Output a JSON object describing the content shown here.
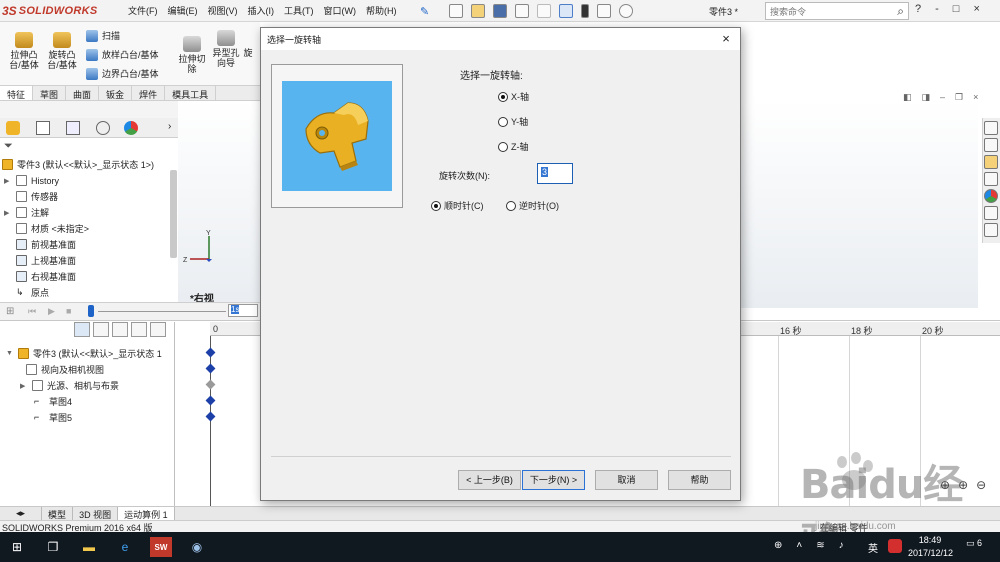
{
  "app": {
    "brand_prefix": "3S",
    "brand": "SOLIDWORKS",
    "menus": [
      "文件(F)",
      "编辑(E)",
      "视图(V)",
      "插入(I)",
      "工具(T)",
      "窗口(W)",
      "帮助(H)"
    ],
    "document_name": "零件3 *",
    "search_placeholder": "搜索命令",
    "win_buttons": [
      "?",
      "-",
      "□",
      "×"
    ]
  },
  "ribbon": {
    "buttons": [
      {
        "label": "拉伸凸\n台/基体"
      },
      {
        "label": "旋转凸\n台/基体"
      },
      {
        "label": "拉伸切\n除"
      },
      {
        "label": "异型孔\n向导"
      },
      {
        "label": "旋"
      }
    ],
    "small": [
      "扫描",
      "放样凸台/基体",
      "边界凸台/基体"
    ]
  },
  "cm_tabs": [
    "特征",
    "草图",
    "曲面",
    "钣金",
    "焊件",
    "模具工具"
  ],
  "feature_tree": {
    "root": "零件3 (默认<<默认>_显示状态 1>)",
    "items": [
      {
        "label": "History",
        "expand": true
      },
      {
        "label": "传感器",
        "expand": false
      },
      {
        "label": "注解",
        "expand": true
      },
      {
        "label": "材质 <未指定>",
        "expand": false
      },
      {
        "label": "前视基准面",
        "expand": false
      },
      {
        "label": "上视基准面",
        "expand": false
      },
      {
        "label": "右视基准面",
        "expand": false
      },
      {
        "label": "原点",
        "expand": false
      }
    ]
  },
  "graphics": {
    "view_label": "*右视",
    "triad": {
      "y": "Y",
      "z": "Z"
    }
  },
  "motion": {
    "time_field": "1s",
    "tree": [
      {
        "label": "零件3 (默认<<默认>_显示状态 1"
      },
      {
        "label": "视向及相机视图"
      },
      {
        "label": "光源、相机与布景"
      },
      {
        "label": "草图4"
      },
      {
        "label": "草图5"
      }
    ],
    "ticks": [
      "0",
      "16 秒",
      "18 秒",
      "20 秒"
    ]
  },
  "bottom_tabs": [
    "模型",
    "3D 视图",
    "运动算例 1"
  ],
  "status_text": "SOLIDWORKS Premium 2016 x64 版",
  "status_right": "在编辑 零件",
  "dialog": {
    "title": "选择一旋转轴",
    "close": "×",
    "axis_label": "选择一旋转轴:",
    "axes": [
      {
        "label": "X-轴",
        "selected": true
      },
      {
        "label": "Y-轴",
        "selected": false
      },
      {
        "label": "Z-轴",
        "selected": false
      }
    ],
    "count_label": "旋转次数(N):",
    "count_value": "3",
    "directions": [
      {
        "label": "顺时针(C)",
        "selected": true
      },
      {
        "label": "逆时针(O)",
        "selected": false
      }
    ],
    "buttons": {
      "back": "< 上一步(B)",
      "next": "下一步(N) >",
      "cancel": "取消",
      "help": "帮助"
    }
  },
  "taskbar": {
    "ime": "英",
    "time": "18:49",
    "date": "2017/12/12",
    "notif_count": "6"
  },
  "watermark": {
    "text": "Baidu经验",
    "sub": "jingyan.baidu.com"
  },
  "colors": {
    "accent": "#1e64c8",
    "preview_bg": "#57b4ee",
    "part_gold": "#e8b022",
    "brand_red": "#c0392b",
    "keyframe_blue": "#1c3fa8"
  }
}
